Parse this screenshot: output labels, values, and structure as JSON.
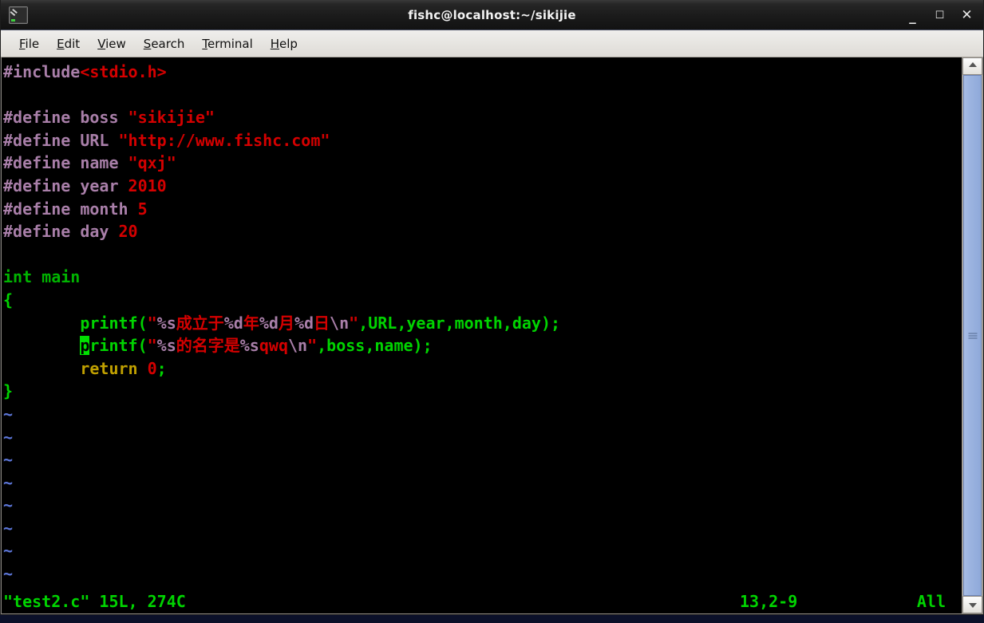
{
  "window": {
    "title": "fishc@localhost:~/sikijie",
    "icon": "terminal-icon",
    "controls": {
      "minimize": "_",
      "maximize": "☐",
      "close": "✕"
    }
  },
  "menubar": {
    "items": [
      {
        "label": "File",
        "mnemonic": "F"
      },
      {
        "label": "Edit",
        "mnemonic": "E"
      },
      {
        "label": "View",
        "mnemonic": "V"
      },
      {
        "label": "Search",
        "mnemonic": "S"
      },
      {
        "label": "Terminal",
        "mnemonic": "T"
      },
      {
        "label": "Help",
        "mnemonic": "H"
      }
    ]
  },
  "editor": {
    "application": "vim",
    "filename": "test2.c",
    "lines": [
      "#include<stdio.h>",
      "",
      "#define boss \"sikijie\"",
      "#define URL \"http://www.fishc.com\"",
      "#define name \"qxj\"",
      "#define year 2010",
      "#define month 5",
      "#define day 20",
      "",
      "int main",
      "{",
      "        printf(\"%s成立于%d年%d月%d日\\n\",URL,year,month,day);",
      "        printf(\"%s的名字是%sqwq\\n\",boss,name);",
      "        return 0;",
      "}"
    ],
    "empty_markers": [
      "~",
      "~",
      "~",
      "~",
      "~",
      "~",
      "~",
      "~"
    ],
    "cursor": {
      "char": "p",
      "line": 13,
      "column": 2
    },
    "colors": {
      "background": "#000000",
      "preprocessor": "#a97fa9",
      "string": "#d40000",
      "identifier": "#00d400",
      "keyword": "#c0a000",
      "tilde": "#5c76d8",
      "cursor_bg": "#00e000"
    }
  },
  "statusline": {
    "file": "\"test2.c\" 15L, 274C",
    "position": "13,2-9",
    "scope": "All"
  },
  "scrollbar": {
    "up_arrow": "scroll-up-icon",
    "down_arrow": "scroll-down-icon",
    "thumb_position": "full"
  },
  "segments": {
    "l0": [
      [
        "#include",
        "pre"
      ],
      [
        "<stdio.h>",
        "str"
      ]
    ],
    "l2": [
      [
        "#define boss ",
        "pre"
      ],
      [
        "\"sikijie\"",
        "str"
      ]
    ],
    "l3": [
      [
        "#define URL ",
        "pre"
      ],
      [
        "\"http://www.fishc.com\"",
        "str"
      ]
    ],
    "l4": [
      [
        "#define name ",
        "pre"
      ],
      [
        "\"qxj\"",
        "str"
      ]
    ],
    "l5": [
      [
        "#define year ",
        "pre"
      ],
      [
        "2010",
        "str"
      ]
    ],
    "l6": [
      [
        "#define month ",
        "pre"
      ],
      [
        "5",
        "str"
      ]
    ],
    "l7": [
      [
        "#define day ",
        "pre"
      ],
      [
        "20",
        "str"
      ]
    ],
    "l9": [
      [
        "int main",
        "type"
      ]
    ],
    "l10": [
      [
        "{",
        "id"
      ]
    ],
    "l11": [
      [
        "        printf(",
        "id"
      ],
      [
        "\"",
        "str"
      ],
      [
        "%s",
        "pre"
      ],
      [
        "成立于",
        "str"
      ],
      [
        "%d",
        "pre"
      ],
      [
        "年",
        "str"
      ],
      [
        "%d",
        "pre"
      ],
      [
        "月",
        "str"
      ],
      [
        "%d",
        "pre"
      ],
      [
        "日",
        "str"
      ],
      [
        "\\n",
        "pre"
      ],
      [
        "\"",
        "str"
      ],
      [
        ",URL,year,month,day);",
        "id"
      ]
    ],
    "l12": [
      [
        "        ",
        "id"
      ],
      [
        "p",
        "cursor"
      ],
      [
        "rintf(",
        "id"
      ],
      [
        "\"",
        "str"
      ],
      [
        "%s",
        "pre"
      ],
      [
        "的名字是",
        "str"
      ],
      [
        "%s",
        "pre"
      ],
      [
        "qwq",
        "str"
      ],
      [
        "\\n",
        "pre"
      ],
      [
        "\"",
        "str"
      ],
      [
        ",boss,name);",
        "id"
      ]
    ],
    "l13": [
      [
        "        ",
        "id"
      ],
      [
        "return",
        "kw"
      ],
      [
        " ",
        "id"
      ],
      [
        "0",
        "str"
      ],
      [
        ";",
        "id"
      ]
    ],
    "l14": [
      [
        "}",
        "id"
      ]
    ]
  }
}
